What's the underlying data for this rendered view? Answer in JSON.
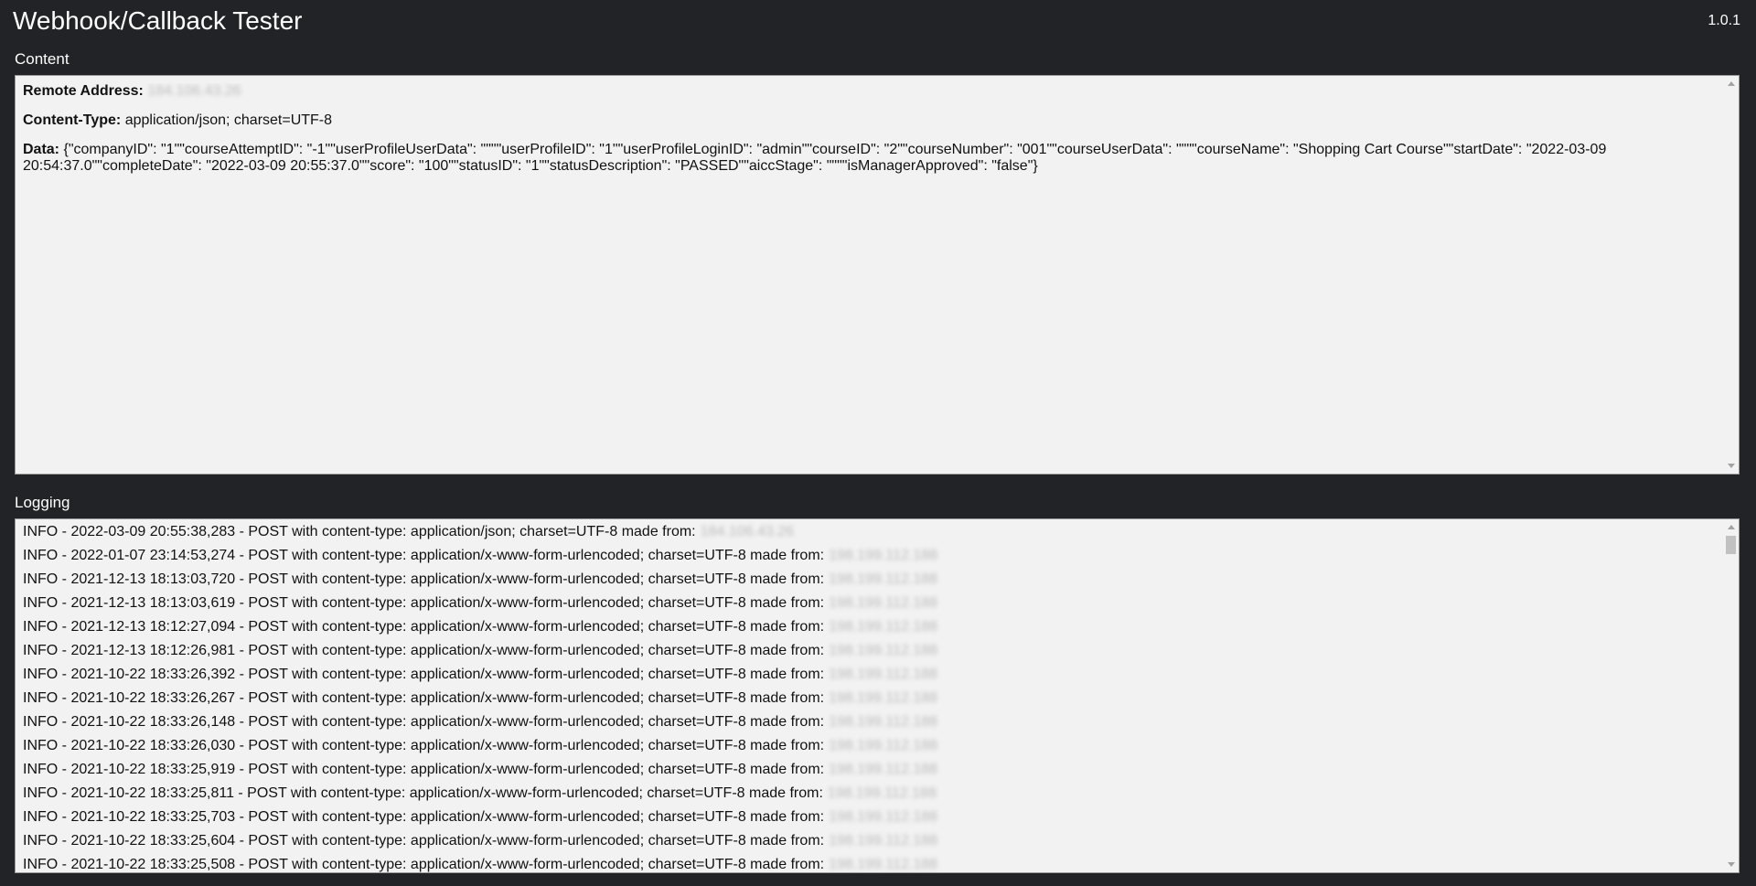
{
  "header": {
    "title": "Webhook/Callback Tester",
    "version": "1.0.1"
  },
  "content_section": {
    "label": "Content",
    "remote_address_label": "Remote Address:",
    "remote_address_value": "184.106.43.26",
    "content_type_label": "Content-Type:",
    "content_type_value": "application/json; charset=UTF-8",
    "data_label": "Data:",
    "data_value": "{\"companyID\": \"1\"\"courseAttemptID\": \"-1\"\"userProfileUserData\": \"\"\"\"userProfileID\": \"1\"\"userProfileLoginID\": \"admin\"\"courseID\": \"2\"\"courseNumber\": \"001\"\"courseUserData\": \"\"\"\"courseName\": \"Shopping Cart Course\"\"startDate\": \"2022-03-09 20:54:37.0\"\"completeDate\": \"2022-03-09 20:55:37.0\"\"score\": \"100\"\"statusID\": \"1\"\"statusDescription\": \"PASSED\"\"aiccStage\": \"\"\"\"isManagerApproved\": \"false\"}"
  },
  "logging_section": {
    "label": "Logging",
    "entries": [
      {
        "text": "INFO - 2022-03-09 20:55:38,283 - POST with content-type: application/json; charset=UTF-8 made from:",
        "ip": "184.106.43.26"
      },
      {
        "text": "INFO - 2022-01-07 23:14:53,274 - POST with content-type: application/x-www-form-urlencoded; charset=UTF-8 made from:",
        "ip": "198.199.112.188"
      },
      {
        "text": "INFO - 2021-12-13 18:13:03,720 - POST with content-type: application/x-www-form-urlencoded; charset=UTF-8 made from:",
        "ip": "198.199.112.188"
      },
      {
        "text": "INFO - 2021-12-13 18:13:03,619 - POST with content-type: application/x-www-form-urlencoded; charset=UTF-8 made from:",
        "ip": "198.199.112.188"
      },
      {
        "text": "INFO - 2021-12-13 18:12:27,094 - POST with content-type: application/x-www-form-urlencoded; charset=UTF-8 made from:",
        "ip": "198.199.112.188"
      },
      {
        "text": "INFO - 2021-12-13 18:12:26,981 - POST with content-type: application/x-www-form-urlencoded; charset=UTF-8 made from:",
        "ip": "198.199.112.188"
      },
      {
        "text": "INFO - 2021-10-22 18:33:26,392 - POST with content-type: application/x-www-form-urlencoded; charset=UTF-8 made from:",
        "ip": "198.199.112.188"
      },
      {
        "text": "INFO - 2021-10-22 18:33:26,267 - POST with content-type: application/x-www-form-urlencoded; charset=UTF-8 made from:",
        "ip": "198.199.112.188"
      },
      {
        "text": "INFO - 2021-10-22 18:33:26,148 - POST with content-type: application/x-www-form-urlencoded; charset=UTF-8 made from:",
        "ip": "198.199.112.188"
      },
      {
        "text": "INFO - 2021-10-22 18:33:26,030 - POST with content-type: application/x-www-form-urlencoded; charset=UTF-8 made from:",
        "ip": "198.199.112.188"
      },
      {
        "text": "INFO - 2021-10-22 18:33:25,919 - POST with content-type: application/x-www-form-urlencoded; charset=UTF-8 made from:",
        "ip": "198.199.112.188"
      },
      {
        "text": "INFO - 2021-10-22 18:33:25,811 - POST with content-type: application/x-www-form-urlencoded; charset=UTF-8 made from:",
        "ip": "198.199.112.188"
      },
      {
        "text": "INFO - 2021-10-22 18:33:25,703 - POST with content-type: application/x-www-form-urlencoded; charset=UTF-8 made from:",
        "ip": "198.199.112.188"
      },
      {
        "text": "INFO - 2021-10-22 18:33:25,604 - POST with content-type: application/x-www-form-urlencoded; charset=UTF-8 made from:",
        "ip": "198.199.112.188"
      },
      {
        "text": "INFO - 2021-10-22 18:33:25,508 - POST with content-type: application/x-www-form-urlencoded; charset=UTF-8 made from:",
        "ip": "198.199.112.188"
      }
    ]
  }
}
